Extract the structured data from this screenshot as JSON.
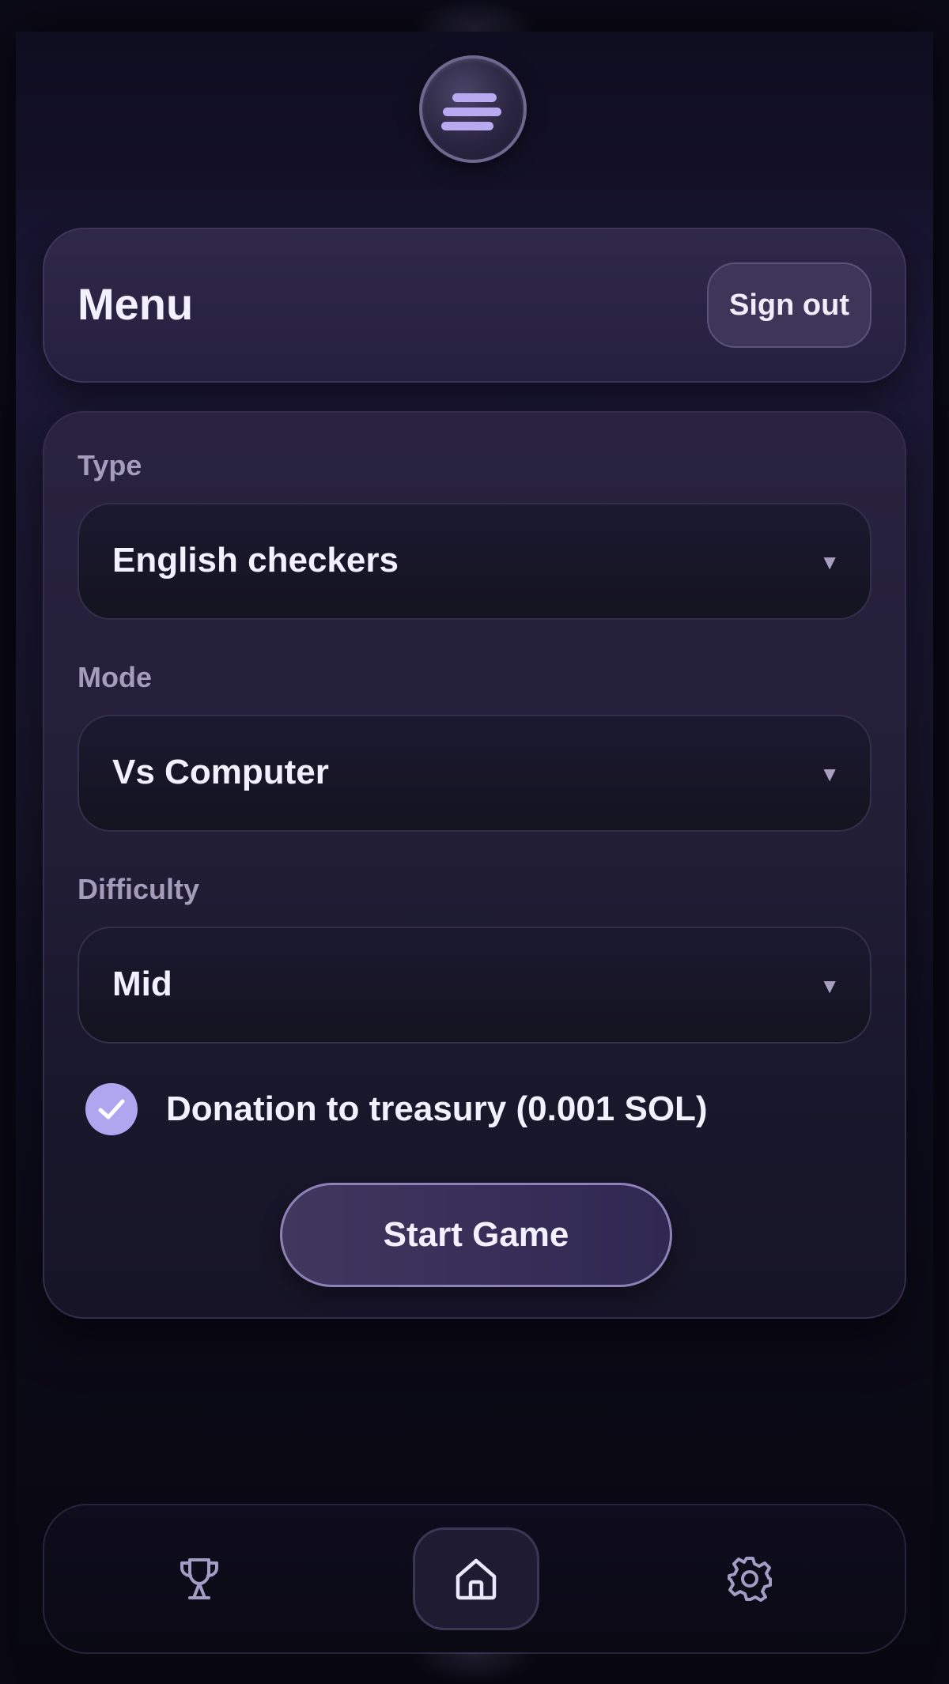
{
  "header": {
    "menu_icon": "menu-icon"
  },
  "title_card": {
    "title": "Menu",
    "sign_out_label": "Sign out"
  },
  "form": {
    "type": {
      "label": "Type",
      "value": "English checkers"
    },
    "mode": {
      "label": "Mode",
      "value": "Vs Computer"
    },
    "difficulty": {
      "label": "Difficulty",
      "value": "Mid"
    },
    "donation": {
      "label": "Donation to treasury (0.001 SOL)",
      "checked": true
    },
    "start_label": "Start Game"
  },
  "nav": {
    "items": [
      {
        "icon": "trophy-icon",
        "active": false
      },
      {
        "icon": "home-icon",
        "active": true
      },
      {
        "icon": "gear-icon",
        "active": false
      }
    ]
  },
  "colors": {
    "accent": "#b0a5ef",
    "background": "#0b0a17",
    "card": "#2f2849"
  }
}
